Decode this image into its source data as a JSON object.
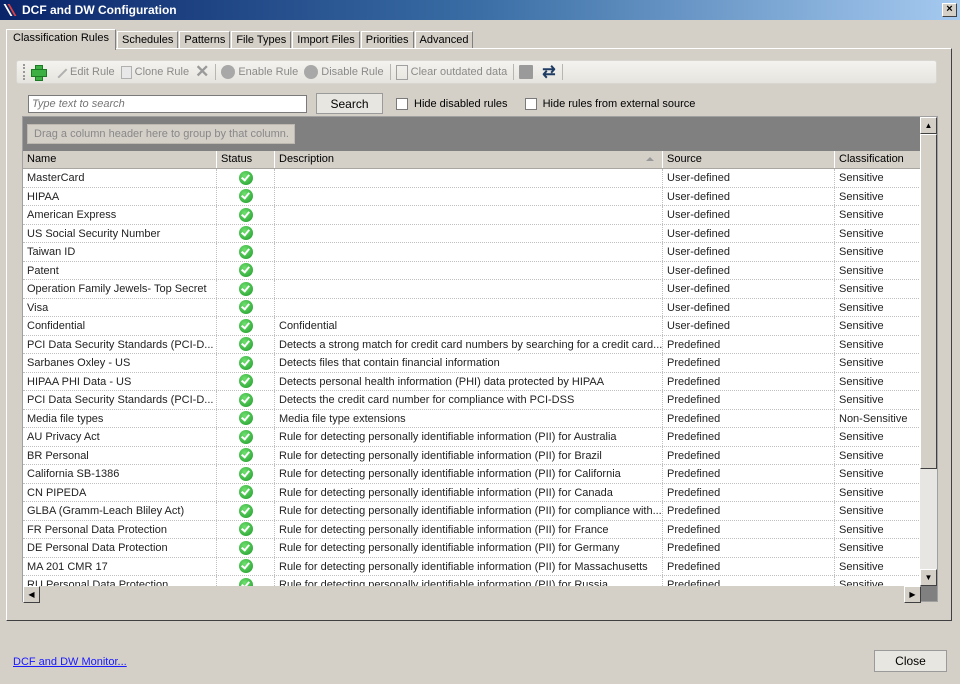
{
  "window": {
    "title": "DCF and DW Configuration",
    "close_label": "×"
  },
  "tabs": [
    {
      "label": "Classification Rules",
      "active": true
    },
    {
      "label": "Schedules"
    },
    {
      "label": "Patterns"
    },
    {
      "label": "File Types"
    },
    {
      "label": "Import Files"
    },
    {
      "label": "Priorities"
    },
    {
      "label": "Advanced"
    }
  ],
  "toolbar": {
    "add_icon": "plus-icon",
    "edit_label": "Edit Rule",
    "clone_label": "Clone Rule",
    "delete_icon": "x-icon",
    "enable_label": "Enable Rule",
    "disable_label": "Disable Rule",
    "clear_label": "Clear outdated data",
    "save_icon": "floppy-icon",
    "refresh_icon": "refresh-icon"
  },
  "search": {
    "placeholder": "Type text to search",
    "button_label": "Search",
    "hide_disabled_label": "Hide disabled rules",
    "hide_external_label": "Hide rules from external source"
  },
  "grid": {
    "group_panel_text": "Drag a column header here to group by that column.",
    "columns": [
      "Name",
      "Status",
      "Description",
      "Source",
      "Classification"
    ],
    "rows": [
      {
        "name": "MasterCard",
        "status": "enabled",
        "desc": "",
        "source": "User-defined",
        "cls": "Sensitive"
      },
      {
        "name": "HIPAA",
        "status": "enabled",
        "desc": "",
        "source": "User-defined",
        "cls": "Sensitive"
      },
      {
        "name": "American Express",
        "status": "enabled",
        "desc": "",
        "source": "User-defined",
        "cls": "Sensitive"
      },
      {
        "name": "US Social Security Number",
        "status": "enabled",
        "desc": "",
        "source": "User-defined",
        "cls": "Sensitive"
      },
      {
        "name": "Taiwan ID",
        "status": "enabled",
        "desc": "",
        "source": "User-defined",
        "cls": "Sensitive"
      },
      {
        "name": "Patent",
        "status": "enabled",
        "desc": "",
        "source": "User-defined",
        "cls": "Sensitive"
      },
      {
        "name": "Operation Family Jewels- Top Secret",
        "status": "enabled",
        "desc": "",
        "source": "User-defined",
        "cls": "Sensitive"
      },
      {
        "name": "Visa",
        "status": "enabled",
        "desc": "",
        "source": "User-defined",
        "cls": "Sensitive"
      },
      {
        "name": "Confidential",
        "status": "enabled",
        "desc": "Confidential",
        "source": "User-defined",
        "cls": "Sensitive"
      },
      {
        "name": "PCI Data Security Standards (PCI-D...",
        "status": "enabled",
        "desc": "Detects a strong match for credit card numbers by searching for a credit card...",
        "source": "Predefined",
        "cls": "Sensitive"
      },
      {
        "name": "Sarbanes Oxley - US",
        "status": "enabled",
        "desc": "Detects files that contain financial information",
        "source": "Predefined",
        "cls": "Sensitive"
      },
      {
        "name": "HIPAA PHI Data - US",
        "status": "enabled",
        "desc": "Detects personal health information (PHI) data protected by HIPAA",
        "source": "Predefined",
        "cls": "Sensitive"
      },
      {
        "name": "PCI Data Security Standards (PCI-D...",
        "status": "enabled",
        "desc": "Detects the credit card number for compliance with PCI-DSS",
        "source": "Predefined",
        "cls": "Sensitive"
      },
      {
        "name": "Media file types",
        "status": "enabled",
        "desc": "Media file type extensions",
        "source": "Predefined",
        "cls": "Non-Sensitive"
      },
      {
        "name": "AU Privacy Act",
        "status": "enabled",
        "desc": "Rule for detecting personally identifiable information (PII) for Australia",
        "source": "Predefined",
        "cls": "Sensitive"
      },
      {
        "name": "BR Personal",
        "status": "enabled",
        "desc": "Rule for detecting personally identifiable information (PII) for Brazil",
        "source": "Predefined",
        "cls": "Sensitive"
      },
      {
        "name": "California SB-1386",
        "status": "enabled",
        "desc": "Rule for detecting personally identifiable information (PII) for California",
        "source": "Predefined",
        "cls": "Sensitive"
      },
      {
        "name": "CN PIPEDA",
        "status": "enabled",
        "desc": "Rule for detecting personally identifiable information (PII) for Canada",
        "source": "Predefined",
        "cls": "Sensitive"
      },
      {
        "name": "GLBA (Gramm-Leach Bliley Act)",
        "status": "enabled",
        "desc": "Rule for detecting personally identifiable information (PII) for compliance with...",
        "source": "Predefined",
        "cls": "Sensitive"
      },
      {
        "name": "FR Personal Data Protection",
        "status": "enabled",
        "desc": "Rule for detecting personally identifiable information (PII) for France",
        "source": "Predefined",
        "cls": "Sensitive"
      },
      {
        "name": "DE Personal Data Protection",
        "status": "enabled",
        "desc": "Rule for detecting personally identifiable information (PII) for Germany",
        "source": "Predefined",
        "cls": "Sensitive"
      },
      {
        "name": "MA 201 CMR 17",
        "status": "enabled",
        "desc": "Rule for detecting personally identifiable information (PII) for Massachusetts",
        "source": "Predefined",
        "cls": "Sensitive"
      },
      {
        "name": "RU Personal Data Protection",
        "status": "enabled",
        "desc": "Rule for detecting personally identifiable information (PII) for Russia",
        "source": "Predefined",
        "cls": "Sensitive"
      }
    ]
  },
  "footer": {
    "monitor_link": "DCF and DW Monitor...",
    "close_label": "Close"
  }
}
